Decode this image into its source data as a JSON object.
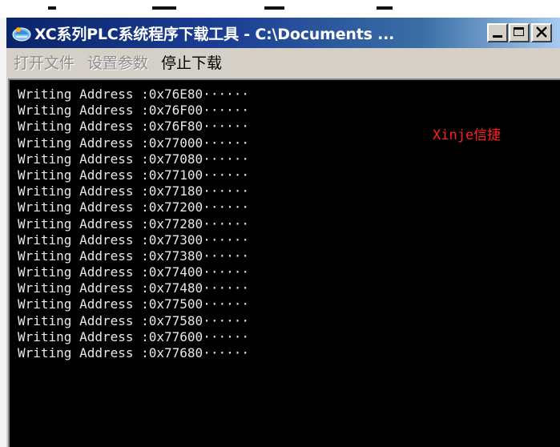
{
  "window": {
    "title": "XC系列PLC系统程序下载工具 - C:\\Documents ..."
  },
  "menu": {
    "items": [
      {
        "label": "打开文件",
        "enabled": false
      },
      {
        "label": "设置参数",
        "enabled": false
      },
      {
        "label": "停止下载",
        "enabled": true
      }
    ]
  },
  "console": {
    "lines": [
      "Writing Address :0x76E80······",
      "Writing Address :0x76F00······",
      "Writing Address :0x76F80······",
      "Writing Address :0x77000······",
      "Writing Address :0x77080······",
      "Writing Address :0x77100······",
      "Writing Address :0x77180······",
      "Writing Address :0x77200······",
      "Writing Address :0x77280······",
      "Writing Address :0x77300······",
      "Writing Address :0x77380······",
      "Writing Address :0x77400······",
      "Writing Address :0x77480······",
      "Writing Address :0x77500······",
      "Writing Address :0x77580······",
      "Writing Address :0x77600······",
      "Writing Address :0x77680······"
    ],
    "watermark": "Xinje信捷",
    "text_color": "#e8e8e8",
    "watermark_color": "#ff2020"
  },
  "icons": {
    "app": "xinje-app-icon",
    "minimize": "minimize-icon",
    "maximize": "maximize-icon",
    "close": "close-icon"
  }
}
